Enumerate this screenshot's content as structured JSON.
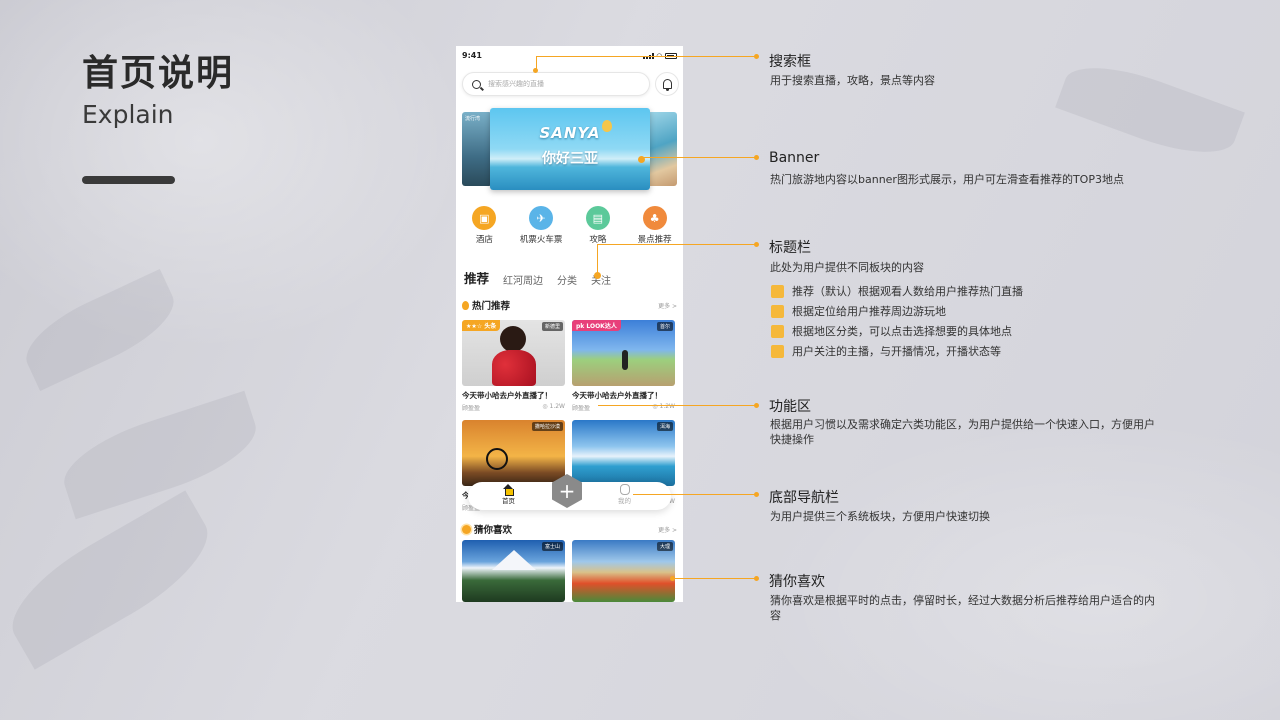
{
  "page": {
    "title": "首页说明",
    "subtitle": "Explain"
  },
  "phone": {
    "status_time": "9:41",
    "search_placeholder": "搜索感兴趣的直播",
    "banner": {
      "left_tag": "流行湾",
      "headline": "SANYA",
      "sub": "你好三亚"
    },
    "quick_entries": [
      {
        "label": "酒店",
        "icon": "hotel-icon",
        "color": "#f5a623"
      },
      {
        "label": "机票火车票",
        "icon": "plane-icon",
        "color": "#5ab4e8"
      },
      {
        "label": "攻略",
        "icon": "guide-icon",
        "color": "#5cc99a"
      },
      {
        "label": "景点推荐",
        "icon": "palm-icon",
        "color": "#f08a3c"
      }
    ],
    "tabs": [
      "推荐",
      "红河周边",
      "分类",
      "关注"
    ],
    "hot_section": {
      "title": "热门推荐",
      "more": "更多 >"
    },
    "guess_section": {
      "title": "猜你喜欢",
      "more": "更多 >"
    },
    "hot_cards": [
      {
        "tag": "新德里",
        "badge": "★★☆ 头条",
        "title": "今天带小哈去户外直播了！",
        "author": "顾盈盈",
        "views": "◎ 1.2W"
      },
      {
        "tag": "首尔",
        "badge": "pk LOOK达人",
        "title": "今天带小哈去户外直播了！",
        "author": "顾盈盈",
        "views": "◎ 1.2W"
      },
      {
        "tag": "撒哈拉沙漠",
        "title": "今",
        "author": "顾盈盈",
        "views": ""
      },
      {
        "tag": "洱海",
        "title": "",
        "author": "",
        "views": ".2W"
      }
    ],
    "guess_cards": [
      {
        "tag": "富士山"
      },
      {
        "tag": "大理"
      }
    ],
    "bottom_nav": {
      "home": "首页",
      "mine": "我的",
      "add": "+"
    }
  },
  "annotations": {
    "search": {
      "title": "搜索框",
      "desc": "用于搜索直播，攻略，景点等内容"
    },
    "banner": {
      "title": "Banner",
      "desc": "热门旅游地内容以banner图形式展示，用户可左滑查看推荐的TOP3地点"
    },
    "tabs": {
      "title": "标题栏",
      "desc": "此处为用户提供不同板块的内容",
      "bullets": [
        "推荐（默认）根据观看人数给用户推荐热门直播",
        "根据定位给用户推荐周边游玩地",
        "根据地区分类，可以点击选择想要的具体地点",
        "用户关注的主播，与开播情况，开播状态等"
      ]
    },
    "features": {
      "title": "功能区",
      "desc": "根据用户习惯以及需求确定六类功能区，为用户提供给一个快速入口，方便用户快捷操作"
    },
    "bottom_nav": {
      "title": "底部导航栏",
      "desc": "为用户提供三个系统板块，方便用户快速切换"
    },
    "guess": {
      "title": "猜你喜欢",
      "desc": "猜你喜欢是根据平时的点击，停留时长，经过大数据分析后推荐给用户适合的内容"
    }
  },
  "colors": {
    "accent": "#f5a623",
    "dark": "#2a2a2a",
    "background": "#d8d8de"
  }
}
